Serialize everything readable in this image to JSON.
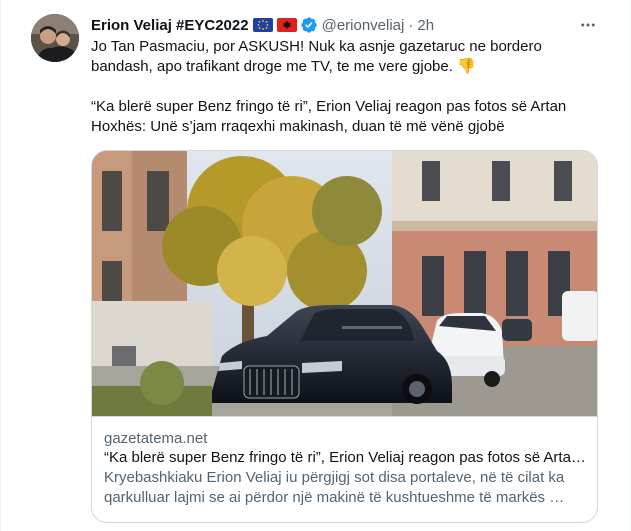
{
  "tweet": {
    "author_name": "Erion Veliaj #EYC2022",
    "handle": "@erionveliaj",
    "separator": "·",
    "time": "2h",
    "text": "Jo Tan Pasmaciu, por ASKUSH! Nuk ka asnje gazetaruc ne bordero bandash, apo trafikant droge me TV, te me vere gjobe. 👎\n\n“Ka blerë super Benz fringo të ri”, Erion Veliaj reagon pas fotos së Artan Hoxhës: Unë s’jam rraqexhi makinash, duan të më vënë gjobë",
    "colors": {
      "text": "#0f1419",
      "secondary": "#536471",
      "verified": "#1d9bf0",
      "border": "#cfd9de"
    }
  },
  "card": {
    "domain": "gazetatema.net",
    "title": "“Ka blerë super Benz fringo të ri”, Erion Veliaj reagon pas fotos së Arta…",
    "description": "Kryebashkiaku Erion Veliaj iu përgjigj sot disa portaleve, në të cilat ka qarkulluar lajmi se ai përdor një makinë të kushtueshme të markës …"
  },
  "icons": {
    "flags": [
      "eu-flag-icon",
      "albania-flag-icon"
    ],
    "verified": "verified-badge-icon",
    "more": "more-options-icon"
  }
}
